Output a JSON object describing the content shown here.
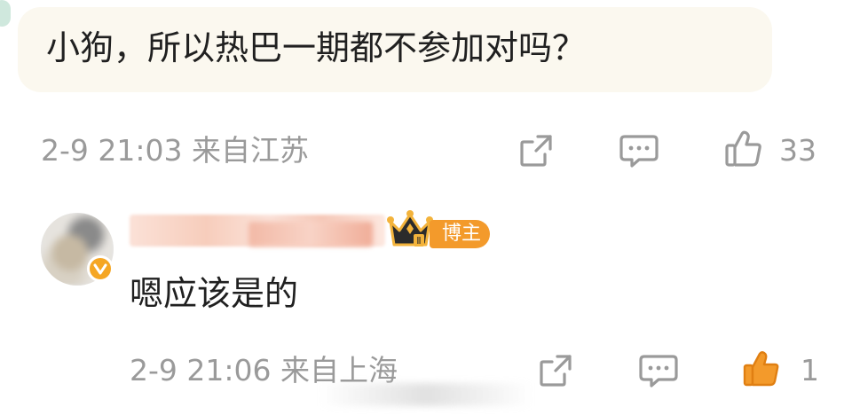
{
  "comment": {
    "text": "小狗，所以热巴一期都不参加对吗？",
    "time": "2-9 21:03",
    "location": "来自江苏",
    "like_count": "33"
  },
  "reply": {
    "badge_label": "博主",
    "text": "嗯应该是的",
    "time": "2-9 21:06",
    "location": "来自上海",
    "like_count": "1"
  },
  "icons": {
    "share": "share-icon",
    "comment": "comment-icon",
    "like": "thumbs-up-icon",
    "crown": "crown-icon",
    "verified": "verified-icon"
  },
  "colors": {
    "bubble_bg": "#fbf8ef",
    "meta_gray": "#9a9a9a",
    "badge_orange": "#f39a2b",
    "liked_orange": "#f39a2b"
  }
}
